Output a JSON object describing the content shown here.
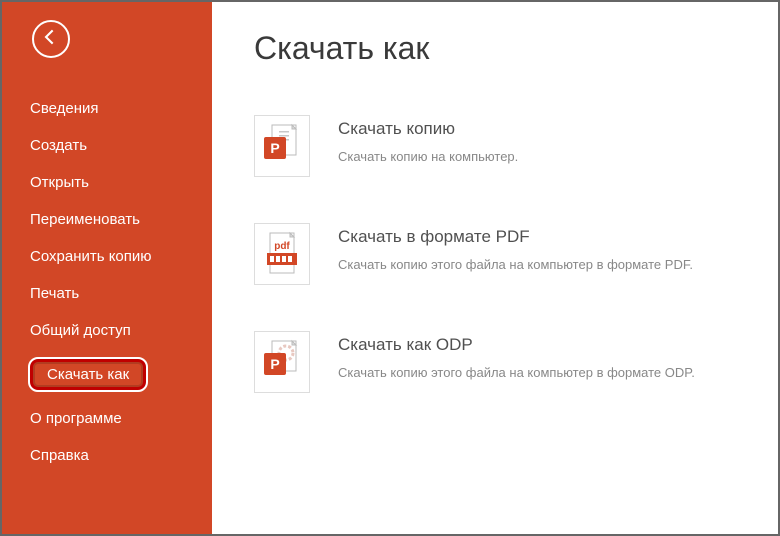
{
  "sidebar": {
    "items": [
      {
        "label": "Сведения",
        "selected": false
      },
      {
        "label": "Создать",
        "selected": false
      },
      {
        "label": "Открыть",
        "selected": false
      },
      {
        "label": "Переименовать",
        "selected": false
      },
      {
        "label": "Сохранить копию",
        "selected": false
      },
      {
        "label": "Печать",
        "selected": false
      },
      {
        "label": "Общий доступ",
        "selected": false
      },
      {
        "label": "Скачать как",
        "selected": true
      },
      {
        "label": "О программе",
        "selected": false
      },
      {
        "label": "Справка",
        "selected": false
      }
    ]
  },
  "page": {
    "title": "Скачать как"
  },
  "options": [
    {
      "icon": "powerpoint-copy-icon",
      "title": "Скачать копию",
      "desc": "Скачать копию на компьютер."
    },
    {
      "icon": "pdf-icon",
      "title": "Скачать в формате PDF",
      "desc": "Скачать копию этого файла на компьютер в формате PDF."
    },
    {
      "icon": "odp-icon",
      "title": "Скачать как ODP",
      "desc": "Скачать копию этого файла на компьютер в формате ODP."
    }
  ]
}
